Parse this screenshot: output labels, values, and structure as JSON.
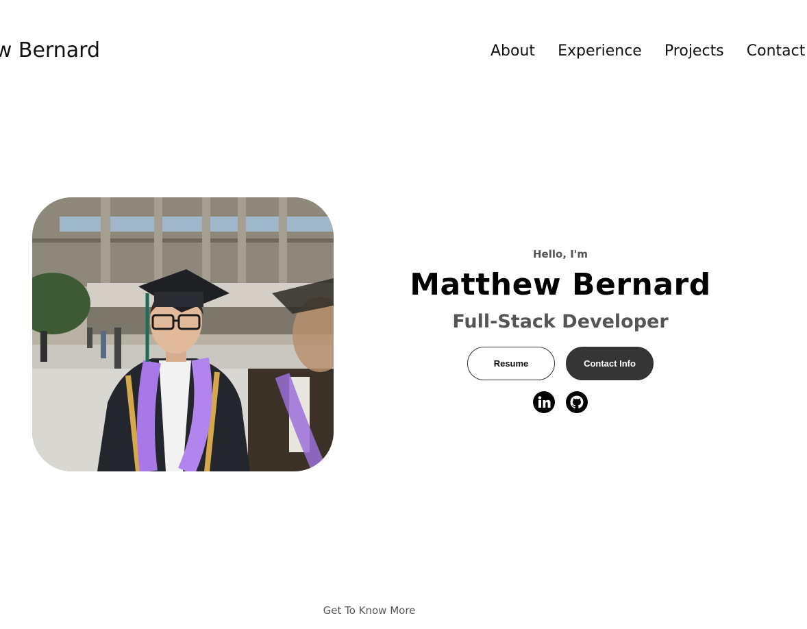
{
  "header": {
    "logo_text": "Matthew Bernard",
    "nav": [
      {
        "label": "About"
      },
      {
        "label": "Experience"
      },
      {
        "label": "Projects"
      },
      {
        "label": "Contact"
      }
    ]
  },
  "hero": {
    "photo_icon": "graduation-photo",
    "greeting": "Hello, I'm",
    "name": "Matthew Bernard",
    "title": "Full-Stack Developer",
    "buttons": {
      "resume": "Resume",
      "contact": "Contact Info"
    },
    "socials": [
      {
        "icon": "linkedin-icon"
      },
      {
        "icon": "github-icon"
      }
    ]
  },
  "footer_hint": "Get To Know More",
  "colors": {
    "text": "#000000",
    "muted": "#555555",
    "button_dark": "#353535",
    "background": "#ffffff"
  }
}
